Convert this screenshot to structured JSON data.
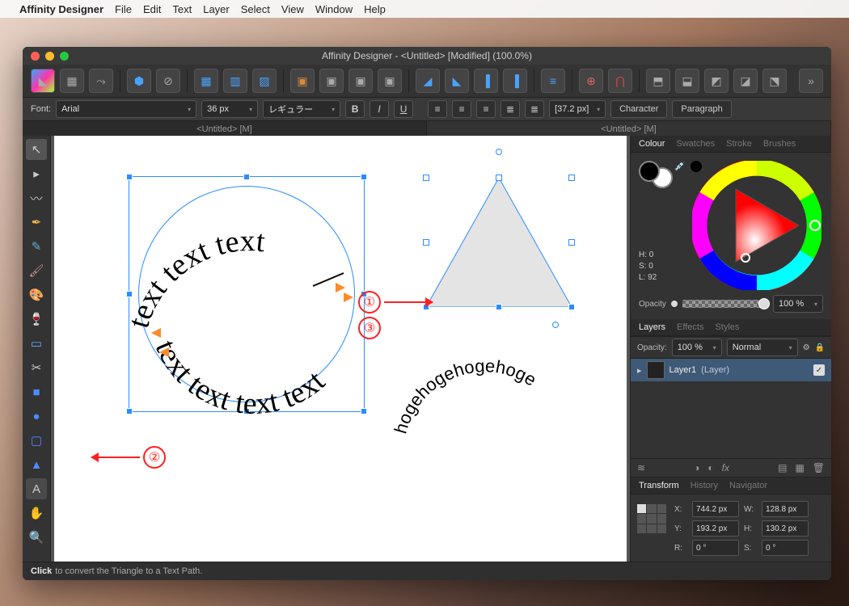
{
  "menubar": {
    "app": "Affinity Designer",
    "items": [
      "File",
      "Edit",
      "Text",
      "Layer",
      "Select",
      "View",
      "Window",
      "Help"
    ]
  },
  "window": {
    "title": "Affinity Designer - <Untitled> [Modified] (100.0%)"
  },
  "options": {
    "font_label": "Font:",
    "font_family": "Arial",
    "font_size": "36 px",
    "font_weight": "レギュラー",
    "selection_width": "[37.2 px]",
    "character_btn": "Character",
    "paragraph_btn": "Paragraph"
  },
  "doc_tabs": {
    "left": "<Untitled> [M]",
    "right": "<Untitled> [M]"
  },
  "callouts": {
    "c1": "①",
    "c2": "②",
    "c3": "③"
  },
  "canvas_text": {
    "top": "text text text",
    "bottom": "text text text text",
    "arc": "hogehogehogehoge"
  },
  "colour_panel": {
    "tabs": {
      "colour": "Colour",
      "swatches": "Swatches",
      "stroke": "Stroke",
      "brushes": "Brushes"
    },
    "h": "H: 0",
    "s": "S: 0",
    "l": "L: 92",
    "opacity_label": "Opacity",
    "opacity_value": "100 %"
  },
  "layers_panel": {
    "tabs": {
      "layers": "Layers",
      "effects": "Effects",
      "styles": "Styles"
    },
    "opacity_label": "Opacity:",
    "opacity_value": "100 %",
    "blend": "Normal",
    "layer_name": "Layer1",
    "layer_kind": "(Layer)"
  },
  "transform_panel": {
    "tabs": {
      "transform": "Transform",
      "history": "History",
      "navigator": "Navigator"
    },
    "x_label": "X:",
    "x": "744.2 px",
    "w_label": "W:",
    "w": "128.8 px",
    "y_label": "Y:",
    "y": "193.2 px",
    "h_label": "H:",
    "h": "130.2 px",
    "r_label": "R:",
    "r": "0 °",
    "s_label": "S:",
    "s": "0 °"
  },
  "status": {
    "strong": "Click",
    "text": " to convert the Triangle to a Text Path."
  },
  "icons": {
    "text": "textx"
  }
}
